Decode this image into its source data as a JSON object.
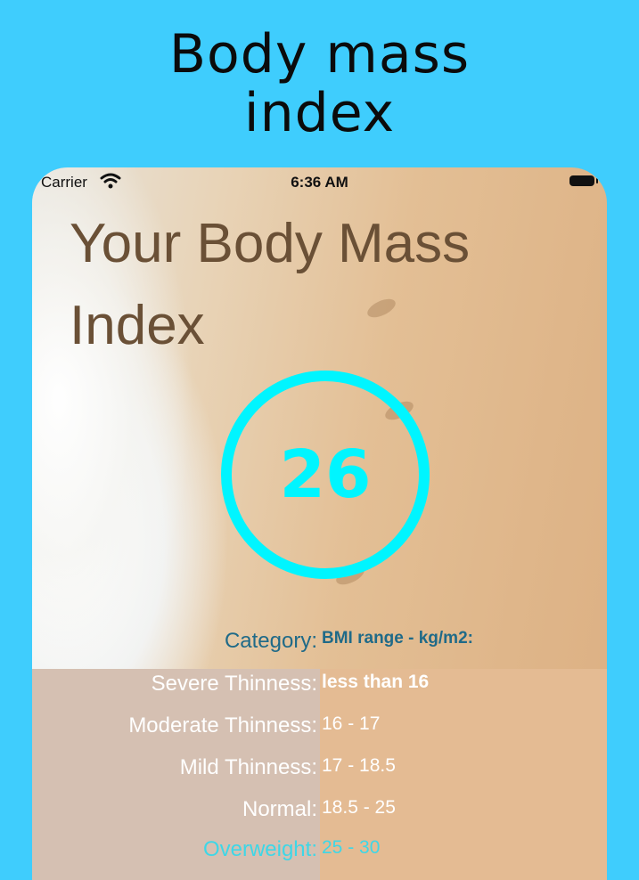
{
  "promo": {
    "title_line1": "Body mass",
    "title_line2": "index"
  },
  "status_bar": {
    "carrier": "Carrier",
    "time": "6:36 AM",
    "wifi_icon": "wifi-icon",
    "battery_icon": "battery-icon"
  },
  "screen": {
    "heading_line1": "Your Body Mass",
    "heading_line2": "Index",
    "bmi_value": "26",
    "accent_color": "#00f5ff"
  },
  "table": {
    "header": {
      "category": "Category:",
      "range": "BMI range - kg/m2:"
    },
    "rows": [
      {
        "category": "Severe Thinness:",
        "range": "less than 16"
      },
      {
        "category": "Moderate Thinness:",
        "range": "16 - 17"
      },
      {
        "category": "Mild Thinness:",
        "range": "17 - 18.5"
      },
      {
        "category": "Normal:",
        "range": "18.5 - 25"
      },
      {
        "category": "Overweight:",
        "range": "25 - 30"
      }
    ]
  }
}
